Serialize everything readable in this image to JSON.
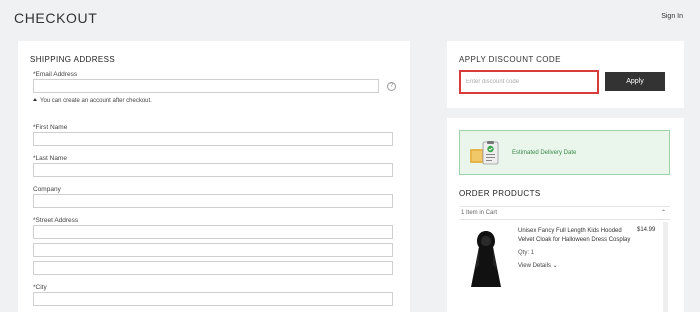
{
  "header": {
    "title": "CHECKOUT",
    "signin_label": "Sign In"
  },
  "shipping": {
    "heading": "SHIPPING ADDRESS",
    "email_label": "*Email Address",
    "account_note": "You can create an account after checkout.",
    "first_name_label": "*First Name",
    "last_name_label": "*Last Name",
    "company_label": "Company",
    "street_label": "*Street Address",
    "city_label": "*City"
  },
  "discount": {
    "heading": "APPLY DISCOUNT CODE",
    "placeholder": "Enter discount code",
    "apply_label": "Apply"
  },
  "delivery": {
    "label": "Estimated Delivery Date"
  },
  "order": {
    "heading": "ORDER PRODUCTS",
    "cart_count": "1 Item in Cart",
    "items": [
      {
        "name": "Unisex Fancy Full Length Kids Hooded Velvet Cloak for Halloween Dress Cosplay",
        "price": "$14.99",
        "qty": "Qty: 1",
        "details_label": "View Details"
      }
    ]
  },
  "colors": {
    "background": "#f0f1f2",
    "error_border": "#d93a3a",
    "button": "#333333",
    "delivery_bg": "#eaf5ec",
    "delivery_text": "#3a8a48"
  }
}
